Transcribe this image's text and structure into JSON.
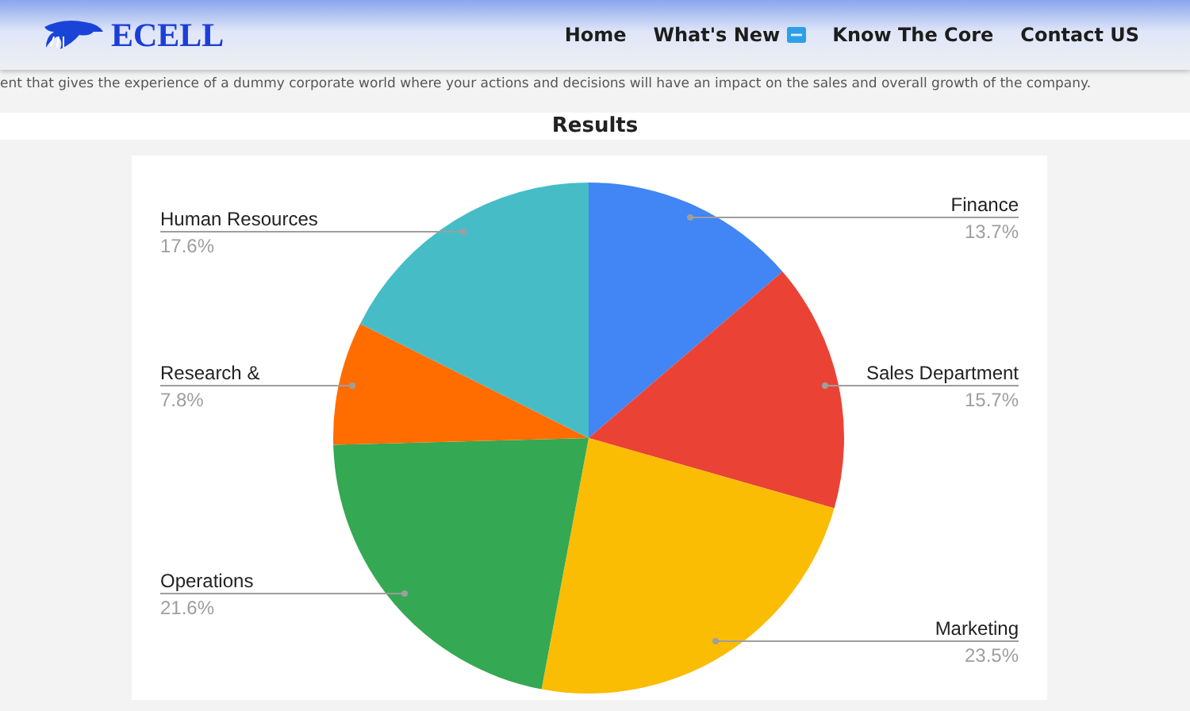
{
  "header": {
    "logo_text": "ECELL",
    "nav": [
      {
        "label": "Home",
        "badge": false
      },
      {
        "label": "What's New",
        "badge": true
      },
      {
        "label": "Know The Core",
        "badge": false
      },
      {
        "label": "Contact US",
        "badge": false
      }
    ]
  },
  "intro_text": "ent that gives the experience of a dummy corporate world where your actions and decisions will have an impact on the sales and overall growth of the company.",
  "section": {
    "title": "Results"
  },
  "chart_data": {
    "type": "pie",
    "categories": [
      "Finance",
      "Sales Department",
      "Marketing",
      "Operations",
      "Research &",
      "Human Resources"
    ],
    "values": [
      13.7,
      15.7,
      23.5,
      21.6,
      7.8,
      17.6
    ],
    "data_labels": true,
    "value_labels": [
      "13.7%",
      "15.7%",
      "23.5%",
      "21.6%",
      "7.8%",
      "17.6%"
    ]
  }
}
